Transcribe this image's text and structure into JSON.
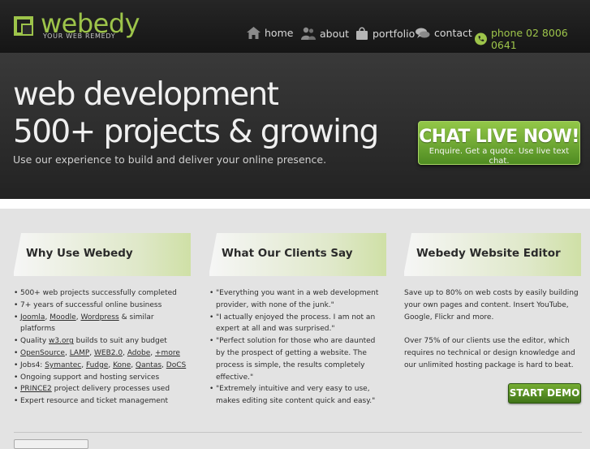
{
  "header": {
    "logo_text": "webedy",
    "logo_tagline": "YOUR WEB REMEDY",
    "nav": [
      {
        "label": "home",
        "icon": "home-icon"
      },
      {
        "label": "about",
        "icon": "people-icon"
      },
      {
        "label": "portfolio",
        "icon": "bag-icon"
      },
      {
        "label": "contact",
        "icon": "speech-bubbles-icon"
      },
      {
        "label": "phone 02 8006 0641",
        "icon": "phone-icon"
      }
    ]
  },
  "hero": {
    "line1": "web development",
    "line2": "500+ projects & growing",
    "subtitle": "Use our experience to build and deliver your online presence.",
    "chat_title": "CHAT LIVE NOW!",
    "chat_sub": "Enquire. Get a quote. Use live text chat."
  },
  "columns": {
    "why": {
      "title": "Why Use Webedy",
      "items": {
        "i1": "500+ web projects successfully completed",
        "i2": "7+ years of successful online business",
        "i3a": "Joomla",
        "i3b": "Moodle",
        "i3c": "Wordpress",
        "i3d": " & similar platforms",
        "i4a": "Quality ",
        "i4b": "w3.org",
        "i4c": " builds to suit any budget",
        "i5a": "OpenSource",
        "i5b": "LAMP",
        "i5c": "WEB2.0",
        "i5d": "Adobe",
        "i5e": "+more",
        "i6a": "Jobs4: ",
        "i6b": "Symantec",
        "i6c": "Fudge",
        "i6d": "Kone",
        "i6e": "Qantas",
        "i6f": "DoCS",
        "i7": "Ongoing support and hosting services",
        "i8a": "PRINCE2",
        "i8b": " project delivery processes used",
        "i9": "Expert resource and ticket management"
      }
    },
    "clients": {
      "title": "What Our Clients Say",
      "quotes": [
        "\"Everything you want in a web development provider, with none of the junk.\"",
        "\"I actually enjoyed the process. I am not an expert at all and was surprised.\"",
        "\"Perfect solution for those who are daunted by the prospect of getting a website. The process is simple, the results completely effective.\"",
        "\"Extremely intuitive and very easy to use, makes editing site content quick and easy.\""
      ]
    },
    "editor": {
      "title": "Webedy Website Editor",
      "para1": "Save up to 80% on web costs by easily building your own pages and content. Insert YouTube, Google, Flickr and more.",
      "para2": "Over 75% of our clients use the editor, which requires no technical or design knowledge and our unlimited hosting package is hard to beat.",
      "demo_label": "START DEMO"
    }
  },
  "colors": {
    "accent": "#9dc44a",
    "button_green": "#5a9a28",
    "header_bg": "#1f1f1f",
    "page_bg": "#e3e3e3"
  }
}
